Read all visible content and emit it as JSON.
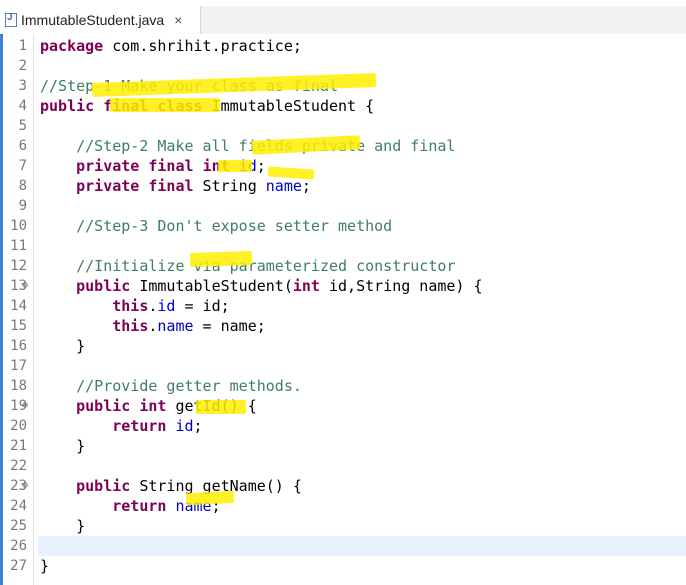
{
  "tab": {
    "filename": "ImmutableStudent.java"
  },
  "lines": [
    {
      "n": "1",
      "tokens": [
        [
          "kw",
          "package"
        ],
        [
          "p",
          " com.shrihit.practice;"
        ]
      ]
    },
    {
      "n": "2",
      "tokens": []
    },
    {
      "n": "3",
      "tokens": [
        [
          "cm",
          "//Step-1 Make your class as final"
        ]
      ]
    },
    {
      "n": "4",
      "tokens": [
        [
          "kw",
          "public"
        ],
        [
          "p",
          " "
        ],
        [
          "kw",
          "final"
        ],
        [
          "p",
          " "
        ],
        [
          "kw",
          "class"
        ],
        [
          "p",
          " ImmutableStudent {"
        ]
      ]
    },
    {
      "n": "5",
      "tokens": []
    },
    {
      "n": "6",
      "tokens": [
        [
          "p",
          "    "
        ],
        [
          "cm",
          "//Step-2 Make all fields private and final"
        ]
      ]
    },
    {
      "n": "7",
      "tokens": [
        [
          "p",
          "    "
        ],
        [
          "kw",
          "private"
        ],
        [
          "p",
          " "
        ],
        [
          "kw",
          "final"
        ],
        [
          "p",
          " "
        ],
        [
          "kw",
          "int"
        ],
        [
          "p",
          " "
        ],
        [
          "fld",
          "id"
        ],
        [
          "p",
          ";"
        ]
      ]
    },
    {
      "n": "8",
      "tokens": [
        [
          "p",
          "    "
        ],
        [
          "kw",
          "private"
        ],
        [
          "p",
          " "
        ],
        [
          "kw",
          "final"
        ],
        [
          "p",
          " String "
        ],
        [
          "fld",
          "name"
        ],
        [
          "p",
          ";"
        ]
      ]
    },
    {
      "n": "9",
      "tokens": []
    },
    {
      "n": "10",
      "tokens": [
        [
          "p",
          "    "
        ],
        [
          "cm",
          "//Step-3 Don't expose setter method"
        ]
      ]
    },
    {
      "n": "11",
      "tokens": []
    },
    {
      "n": "12",
      "tokens": [
        [
          "p",
          "    "
        ],
        [
          "cm",
          "//Initialize via parameterized constructor"
        ]
      ]
    },
    {
      "n": "13",
      "fold": true,
      "tokens": [
        [
          "p",
          "    "
        ],
        [
          "kw",
          "public"
        ],
        [
          "p",
          " ImmutableStudent("
        ],
        [
          "kw",
          "int"
        ],
        [
          "p",
          " id,String name) {"
        ]
      ]
    },
    {
      "n": "14",
      "tokens": [
        [
          "p",
          "        "
        ],
        [
          "kw",
          "this"
        ],
        [
          "p",
          "."
        ],
        [
          "fld",
          "id"
        ],
        [
          "p",
          " = id;"
        ]
      ]
    },
    {
      "n": "15",
      "tokens": [
        [
          "p",
          "        "
        ],
        [
          "kw",
          "this"
        ],
        [
          "p",
          "."
        ],
        [
          "fld",
          "name"
        ],
        [
          "p",
          " = name;"
        ]
      ]
    },
    {
      "n": "16",
      "tokens": [
        [
          "p",
          "    }"
        ]
      ]
    },
    {
      "n": "17",
      "tokens": []
    },
    {
      "n": "18",
      "tokens": [
        [
          "p",
          "    "
        ],
        [
          "cm",
          "//Provide getter methods."
        ]
      ]
    },
    {
      "n": "19",
      "fold": true,
      "tokens": [
        [
          "p",
          "    "
        ],
        [
          "kw",
          "public"
        ],
        [
          "p",
          " "
        ],
        [
          "kw",
          "int"
        ],
        [
          "p",
          " getId() {"
        ]
      ]
    },
    {
      "n": "20",
      "tokens": [
        [
          "p",
          "        "
        ],
        [
          "kw",
          "return"
        ],
        [
          "p",
          " "
        ],
        [
          "fld",
          "id"
        ],
        [
          "p",
          ";"
        ]
      ]
    },
    {
      "n": "21",
      "tokens": [
        [
          "p",
          "    }"
        ]
      ]
    },
    {
      "n": "22",
      "tokens": []
    },
    {
      "n": "23",
      "fold": true,
      "tokens": [
        [
          "p",
          "    "
        ],
        [
          "kw",
          "public"
        ],
        [
          "p",
          " String getName() {"
        ]
      ]
    },
    {
      "n": "24",
      "tokens": [
        [
          "p",
          "        "
        ],
        [
          "kw",
          "return"
        ],
        [
          "p",
          " "
        ],
        [
          "fld",
          "name"
        ],
        [
          "p",
          ";"
        ]
      ]
    },
    {
      "n": "25",
      "tokens": [
        [
          "p",
          "    }"
        ]
      ]
    },
    {
      "n": "26",
      "current": true,
      "tokens": []
    },
    {
      "n": "27",
      "tokens": [
        [
          "p",
          "}"
        ]
      ]
    }
  ],
  "colors": {
    "keyword": "#7f0055",
    "comment": "#3f7f5f",
    "field": "#0000c0",
    "highlighter": "#ffee00",
    "current_line": "#e8f2fe",
    "gutter_bar": "#3c82d6"
  }
}
